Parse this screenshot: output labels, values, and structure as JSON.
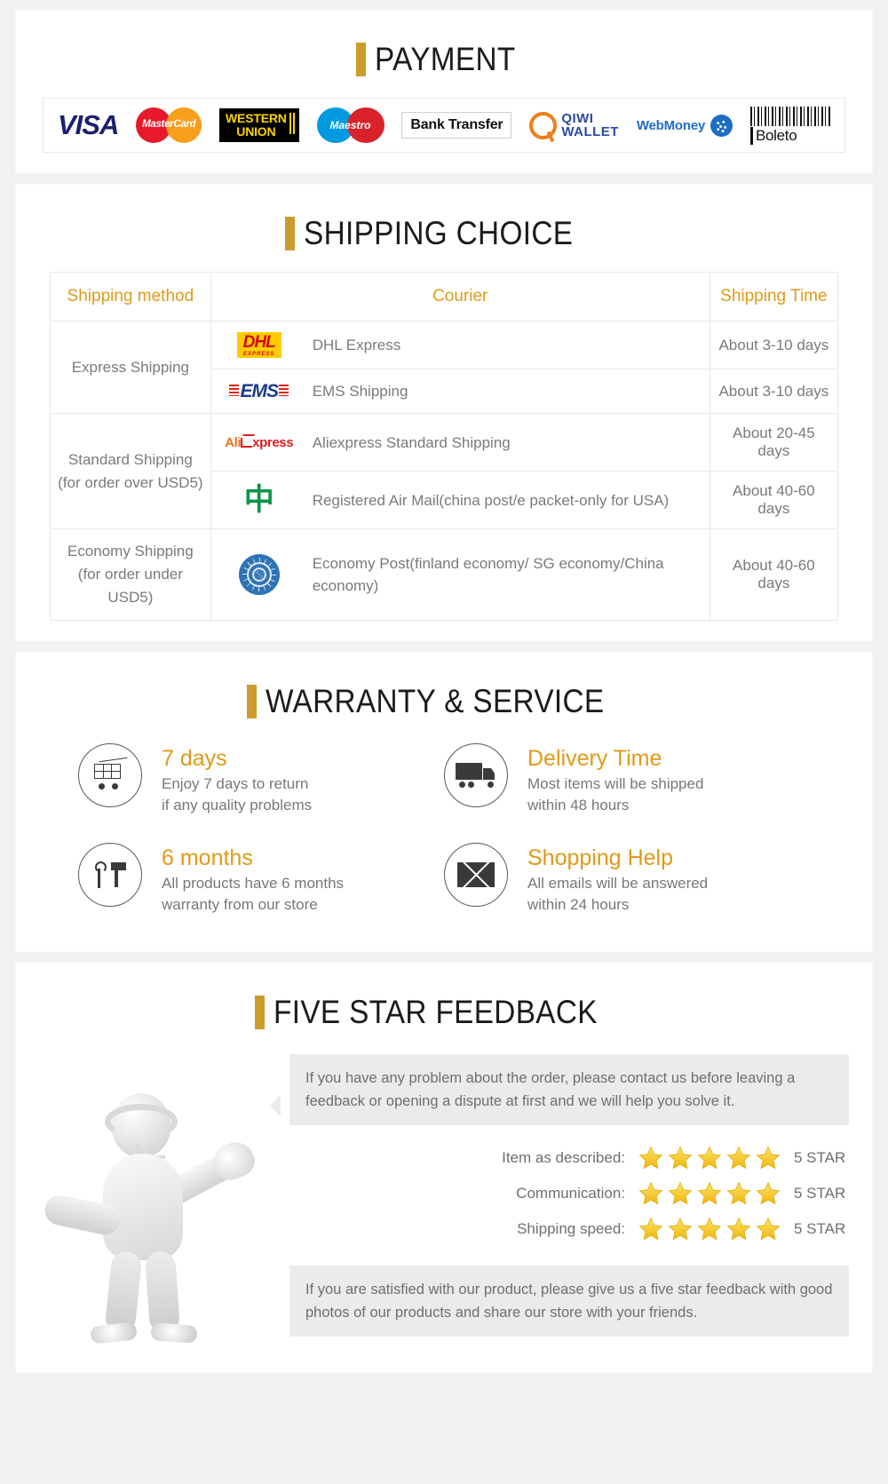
{
  "payment": {
    "heading": "PAYMENT",
    "methods": [
      {
        "name": "visa",
        "label": "VISA"
      },
      {
        "name": "mastercard",
        "label": "MasterCard"
      },
      {
        "name": "western-union",
        "line1": "WESTERN",
        "line2": "UNION"
      },
      {
        "name": "maestro",
        "label": "Maestro"
      },
      {
        "name": "bank-transfer",
        "label": "Bank Transfer"
      },
      {
        "name": "qiwi-wallet",
        "line1": "QIWI",
        "line2": "WALLET"
      },
      {
        "name": "webmoney",
        "label": "WebMoney"
      },
      {
        "name": "boleto",
        "label": "Boleto"
      }
    ]
  },
  "shipping": {
    "heading": "SHIPPING CHOICE",
    "columns": [
      "Shipping method",
      "Courier",
      "Shipping Time"
    ],
    "rows": [
      {
        "method": "Express Shipping",
        "method_sub": "",
        "entries": [
          {
            "logo": "dhl",
            "logo_text": "DHL",
            "logo_sub": "EXPRESS",
            "courier": "DHL Express",
            "time": "About 3-10 days"
          },
          {
            "logo": "ems",
            "logo_text": "EMS",
            "courier": "EMS Shipping",
            "time": "About 3-10 days"
          }
        ]
      },
      {
        "method": "Standard Shipping",
        "method_sub": "(for order over USD5)",
        "entries": [
          {
            "logo": "aliexpress",
            "logo_text": "Aliexpress",
            "courier": "Aliexpress Standard Shipping",
            "time": "About 20-45 days"
          },
          {
            "logo": "china-post",
            "logo_text": "China Post",
            "courier": "Registered Air Mail(china post/e packet-only for USA)",
            "time": "About 40-60 days"
          }
        ]
      },
      {
        "method": "Economy Shipping",
        "method_sub": "(for order under USD5)",
        "entries": [
          {
            "logo": "un-post",
            "logo_text": "Economy Post",
            "courier": "Economy Post(finland economy/ SG economy/China economy)",
            "time": "About 40-60 days"
          }
        ]
      }
    ]
  },
  "warranty": {
    "heading": "WARRANTY & SERVICE",
    "items": [
      {
        "icon": "shopping-cart-icon",
        "title": "7 days",
        "line1": "Enjoy 7 days to return",
        "line2": "if any quality problems"
      },
      {
        "icon": "delivery-truck-icon",
        "title": "Delivery Time",
        "line1": "Most items will be shipped",
        "line2": "within 48 hours"
      },
      {
        "icon": "tools-icon",
        "title": "6 months",
        "line1": "All products have 6 months",
        "line2": "warranty from our store"
      },
      {
        "icon": "envelope-icon",
        "title": "Shopping Help",
        "line1": "All emails will be answered",
        "line2": "within 24 hours"
      }
    ]
  },
  "feedback": {
    "heading": "FIVE STAR FEEDBACK",
    "bubble_top": "If you have any problem about the order, please contact us before leaving a feedback or opening a dispute at first and we will help you solve it.",
    "ratings": [
      {
        "label": "Item as described:",
        "stars": 5,
        "value": "5 STAR"
      },
      {
        "label": "Communication:",
        "stars": 5,
        "value": "5 STAR"
      },
      {
        "label": "Shipping speed:",
        "stars": 5,
        "value": "5 STAR"
      }
    ],
    "bubble_bottom": "If you are satisfied with our product, please give us a five star feedback with good photos of our products and share our store with your friends."
  },
  "colors": {
    "accent_gold": "#cb9b2c",
    "heading_text": "#1b1b1b",
    "body_text": "#777777",
    "table_header": "#e09a18",
    "star": "#f5c518"
  }
}
